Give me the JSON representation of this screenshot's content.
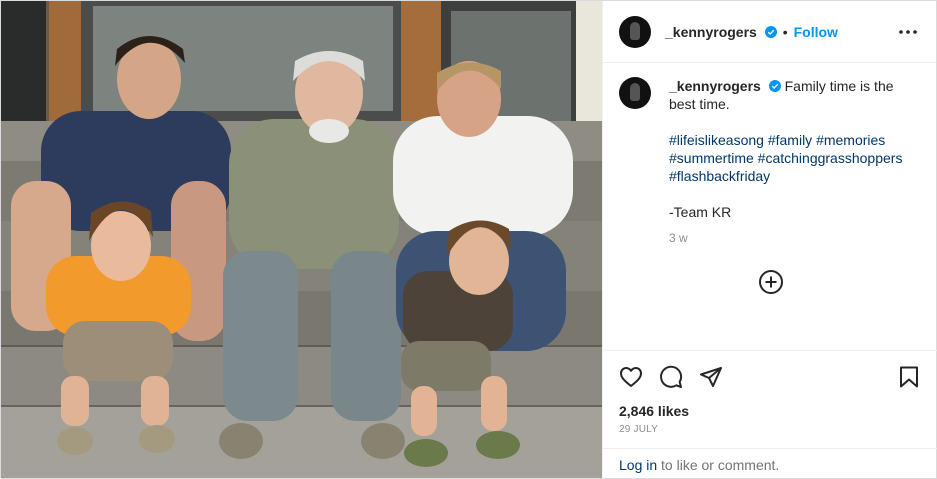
{
  "post": {
    "photo_alt": "Family photo on steps",
    "author": {
      "username": "_kennyrogers",
      "verified": true,
      "follow_label": "Follow",
      "dot": "•"
    },
    "caption": {
      "text": "Family time is the best time.",
      "hashtags_line1": "#lifeislikeasong #family #memories",
      "hashtags_line2": "#summertime #catchinggrasshoppers",
      "hashtags_line3": "#flashbackfriday",
      "signoff": "-Team KR",
      "age": "3 w"
    },
    "likes": "2,846 likes",
    "date": "29 July",
    "login_prompt": {
      "link": "Log in",
      "rest": "to like or comment."
    }
  },
  "icons": {
    "more": "more-options-icon",
    "verified": "verified-badge-icon",
    "add_comment": "add-comment-icon",
    "like": "heart-icon",
    "comment": "comment-icon",
    "share": "share-icon",
    "save": "bookmark-icon"
  },
  "colors": {
    "follow": "#0095f6",
    "hashtag": "#00376b",
    "verified": "#0095f6",
    "muted": "#8e8e8e"
  }
}
